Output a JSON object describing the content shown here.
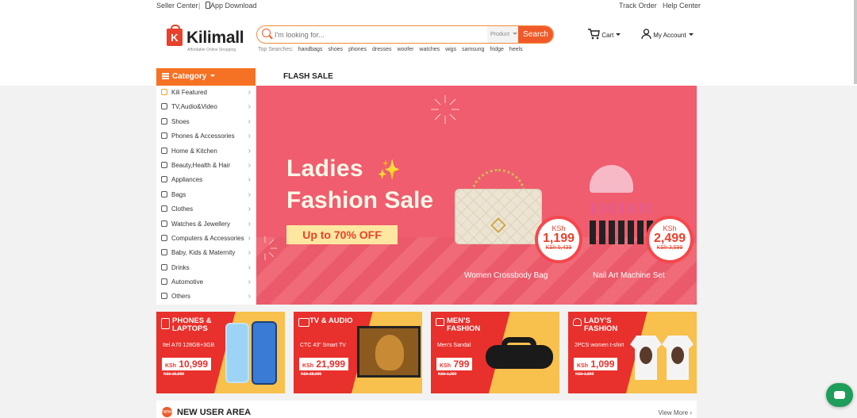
{
  "topbar": {
    "seller_center": "Seller Center",
    "separator": "|",
    "app_download": "App Download",
    "track_order": "Track Order",
    "help_center": "Help Center"
  },
  "header": {
    "logo_letter": "K",
    "brand": "Kilimall",
    "tagline": "Affordable Online Shopping",
    "search": {
      "placeholder": "I'm looking for...",
      "scope": "Product",
      "button": "Search"
    },
    "top_searches_label": "Top Searches:",
    "top_searches": [
      "handbags",
      "shoes",
      "phones",
      "dresses",
      "woofer",
      "watches",
      "wigs",
      "samsung",
      "fridge",
      "heels"
    ],
    "cart": "Cart",
    "account": "My Account"
  },
  "category": {
    "title": "Category",
    "items": [
      "Kili Featured",
      "TV,Audio&Video",
      "Shoes",
      "Phones & Accessories",
      "Home & Kitchen",
      "Beauty,Health & Hair",
      "Appliances",
      "Bags",
      "Clothes",
      "Watches & Jewellery",
      "Computers & Accessories",
      "Baby, Kids & Maternity",
      "Drinks",
      "Automotive",
      "Others"
    ]
  },
  "flash_sale": "FLASH SALE",
  "banner": {
    "line1": "Ladies",
    "line2": "Fashion Sale",
    "sparkle": "✨",
    "promo": "Up to 70% OFF",
    "product1": {
      "currency": "KSh",
      "price": "1,199",
      "old": "KSh 5,439",
      "caption": "Women Crossbody Bag"
    },
    "product2": {
      "currency": "KSh",
      "price": "2,499",
      "old": "KSh 3,599",
      "caption": "Nail Art Machine Set"
    }
  },
  "tiles": [
    {
      "title": "PHONES & LAPTOPS",
      "product": "Itel A70 128GB+3GB",
      "currency": "KSh",
      "price": "10,999",
      "old": "KSh 15,999"
    },
    {
      "title": "TV & AUDIO",
      "product": "CTC 43\" Smart TV",
      "currency": "KSh",
      "price": "21,999",
      "old": "KSh 28,999"
    },
    {
      "title": "MEN'S FASHION",
      "product": "Men's Sandal",
      "currency": "KSh",
      "price": "799",
      "old": "KSh 1,299"
    },
    {
      "title": "LADY'S FASHION",
      "product": "2PCS women t-shirt",
      "currency": "KSh",
      "price": "1,099",
      "old": "KSh 1,899"
    }
  ],
  "new_user": {
    "icon": "new",
    "title": "NEW USER AREA",
    "view_more": "View More ›"
  },
  "colors": {
    "accent": "#f57224",
    "banner": "#ef5d6e",
    "tile_red": "#e8302c",
    "tile_yellow": "#f8c04c",
    "chat": "#1f9d5a"
  }
}
